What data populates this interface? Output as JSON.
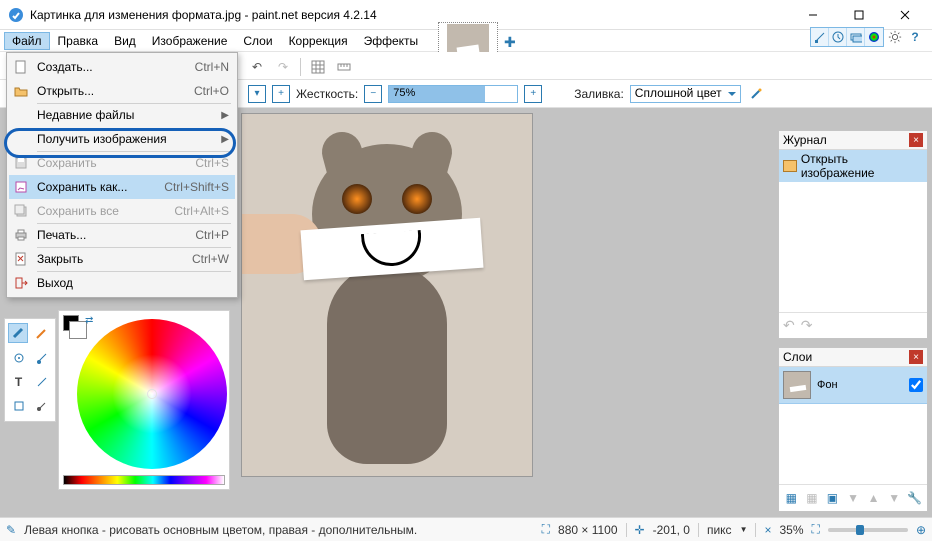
{
  "title": "Картинка для изменения формата.jpg - paint.net версия 4.2.14",
  "menu": {
    "file": "Файл",
    "edit": "Правка",
    "view": "Вид",
    "image": "Изображение",
    "layers": "Слои",
    "adjust": "Коррекция",
    "effects": "Эффекты"
  },
  "file_menu": {
    "new": {
      "label": "Создать...",
      "shortcut": "Ctrl+N"
    },
    "open": {
      "label": "Открыть...",
      "shortcut": "Ctrl+O"
    },
    "recent": {
      "label": "Недавние файлы"
    },
    "acquire": {
      "label": "Получить изображения"
    },
    "save": {
      "label": "Сохранить",
      "shortcut": "Ctrl+S"
    },
    "save_as": {
      "label": "Сохранить как...",
      "shortcut": "Ctrl+Shift+S"
    },
    "save_all": {
      "label": "Сохранить все",
      "shortcut": "Ctrl+Alt+S"
    },
    "print": {
      "label": "Печать...",
      "shortcut": "Ctrl+P"
    },
    "close": {
      "label": "Закрыть",
      "shortcut": "Ctrl+W"
    },
    "exit": {
      "label": "Выход"
    }
  },
  "toolbar2": {
    "hardness_label": "Жесткость:",
    "hardness_value": "75%",
    "fill_label": "Заливка:",
    "fill_value": "Сплошной цвет"
  },
  "history": {
    "title": "Журнал",
    "item0": "Открыть изображение"
  },
  "layers": {
    "title": "Слои",
    "bg": "Фон"
  },
  "status": {
    "hint": "Левая кнопка - рисовать основным цветом, правая - дополнительным.",
    "dims": "880 × 1100",
    "cursor": "-201, 0",
    "units": "пикс",
    "zoom": "35%"
  }
}
